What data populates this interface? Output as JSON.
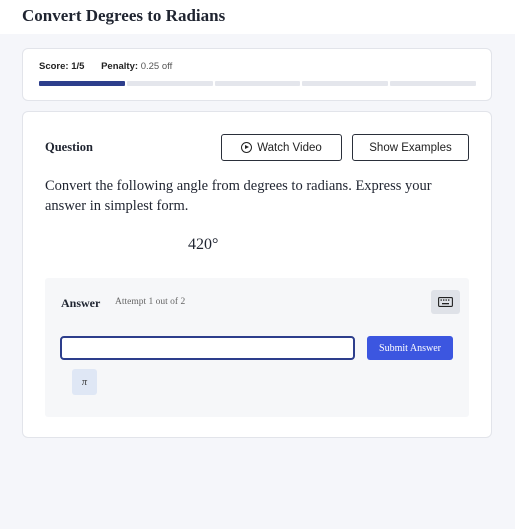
{
  "header": {
    "title": "Convert Degrees to Radians"
  },
  "score": {
    "score_label": "Score:",
    "score_value": "1/5",
    "penalty_label": "Penalty:",
    "penalty_value": "0.25 off",
    "progress_segments": 5,
    "progress_completed": 1
  },
  "question": {
    "label": "Question",
    "watch_video_label": "Watch Video",
    "show_examples_label": "Show Examples",
    "text": "Convert the following angle from degrees to radians. Express your answer in simplest form.",
    "expression": "420°"
  },
  "answer": {
    "label": "Answer",
    "attempt_text": "Attempt 1 out of 2",
    "input_value": "",
    "input_placeholder": "",
    "submit_label": "Submit Answer",
    "pi_button_label": "π",
    "keyboard_icon": "keyboard-icon"
  },
  "colors": {
    "accent": "#3c56e0",
    "progress_done": "#2d3e8c",
    "progress_todo": "#e4e6ec",
    "input_border": "#2d3e8c"
  },
  "icons": {
    "video": "play-circle-icon",
    "keyboard": "keyboard-icon"
  }
}
